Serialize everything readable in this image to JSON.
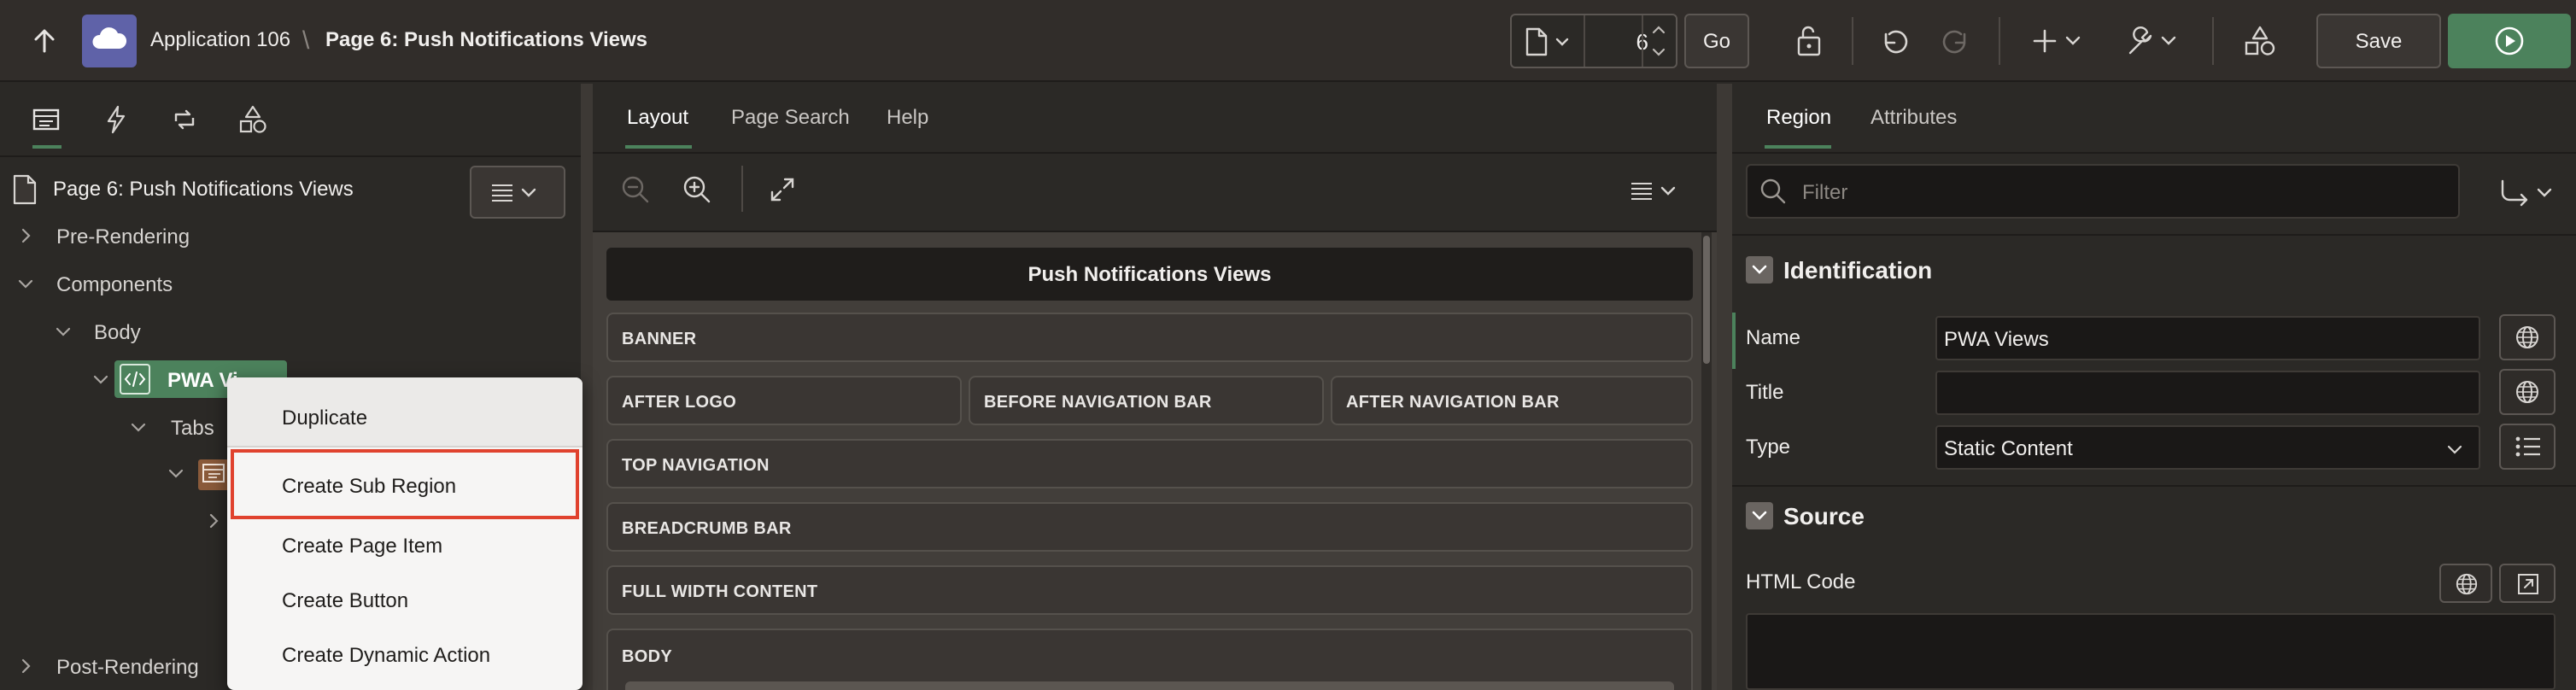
{
  "toolbar": {
    "app_name": "Application 106",
    "separator": "\\",
    "page_title": "Page 6: Push Notifications Views",
    "page_number": "6",
    "go_label": "Go",
    "save_label": "Save"
  },
  "left": {
    "page_node": "Page 6: Push Notifications Views",
    "tree": {
      "pre_rendering": "Pre-Rendering",
      "components": "Components",
      "body": "Body",
      "pwa_region": "PWA Vi",
      "tabs": "Tabs",
      "post_rendering": "Post-Rendering"
    }
  },
  "context_menu": {
    "items": [
      "Duplicate",
      "Create Sub Region",
      "Create Page Item",
      "Create Button",
      "Create Dynamic Action"
    ]
  },
  "middle": {
    "tabs": [
      "Layout",
      "Page Search",
      "Help"
    ],
    "page_header": "Push Notifications Views",
    "regions": {
      "banner": "BANNER",
      "after_logo": "AFTER LOGO",
      "before_nav": "BEFORE NAVIGATION BAR",
      "after_nav": "AFTER NAVIGATION BAR",
      "top_nav": "TOP NAVIGATION",
      "breadcrumb": "BREADCRUMB BAR",
      "full_width": "FULL WIDTH CONTENT",
      "body": "BODY"
    }
  },
  "right": {
    "tabs": [
      "Region",
      "Attributes"
    ],
    "filter_placeholder": "Filter",
    "identification": {
      "heading": "Identification",
      "name_label": "Name",
      "name_value": "PWA Views",
      "title_label": "Title",
      "title_value": "",
      "type_label": "Type",
      "type_value": "Static Content"
    },
    "source": {
      "heading": "Source",
      "html_code_label": "HTML Code"
    }
  },
  "colors": {
    "accent_green": "#4c825c",
    "highlight_red": "#e0422e",
    "tree_selected": "#4c825c"
  }
}
